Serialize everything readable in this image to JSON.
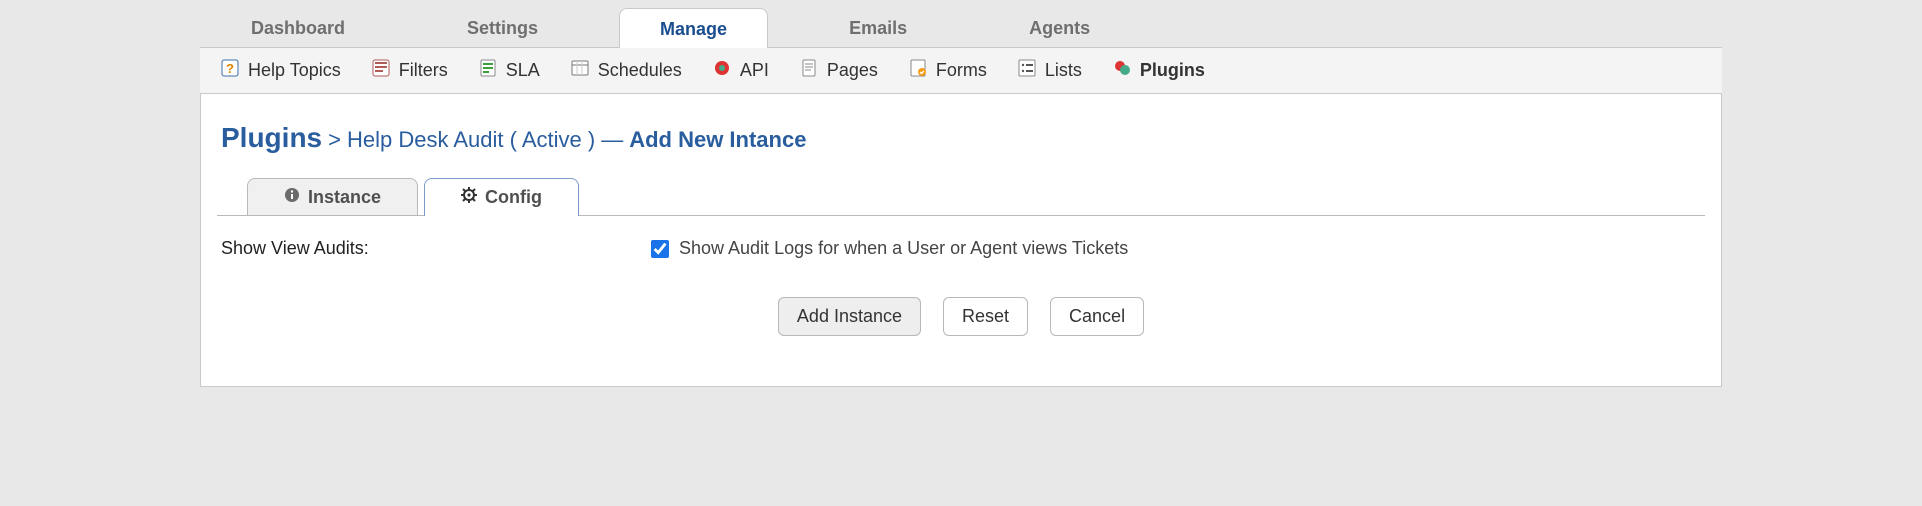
{
  "main_nav": {
    "items": [
      {
        "label": "Dashboard",
        "active": false
      },
      {
        "label": "Settings",
        "active": false
      },
      {
        "label": "Manage",
        "active": true
      },
      {
        "label": "Emails",
        "active": false
      },
      {
        "label": "Agents",
        "active": false
      }
    ]
  },
  "sub_nav": {
    "items": [
      {
        "label": "Help Topics",
        "icon": "help-topics-icon",
        "active": false
      },
      {
        "label": "Filters",
        "icon": "filters-icon",
        "active": false
      },
      {
        "label": "SLA",
        "icon": "sla-icon",
        "active": false
      },
      {
        "label": "Schedules",
        "icon": "schedules-icon",
        "active": false
      },
      {
        "label": "API",
        "icon": "api-icon",
        "active": false
      },
      {
        "label": "Pages",
        "icon": "pages-icon",
        "active": false
      },
      {
        "label": "Forms",
        "icon": "forms-icon",
        "active": false
      },
      {
        "label": "Lists",
        "icon": "lists-icon",
        "active": false
      },
      {
        "label": "Plugins",
        "icon": "plugins-icon",
        "active": true
      }
    ]
  },
  "breadcrumb": {
    "root": "Plugins",
    "sep": ">",
    "mid": "Help Desk Audit ( Active )",
    "dash": "—",
    "tail": "Add New Intance"
  },
  "secondary_tabs": {
    "items": [
      {
        "label": "Instance",
        "icon": "info-icon",
        "active": false
      },
      {
        "label": "Config",
        "icon": "gear-icon",
        "active": true
      }
    ]
  },
  "form": {
    "row1": {
      "label": "Show View Audits:",
      "checkbox_checked": true,
      "description": "Show Audit Logs for when a User or Agent views Tickets"
    }
  },
  "actions": {
    "add": "Add Instance",
    "reset": "Reset",
    "cancel": "Cancel"
  },
  "colors": {
    "link": "#2a5d9e",
    "accent_border": "#7a9cc7"
  }
}
